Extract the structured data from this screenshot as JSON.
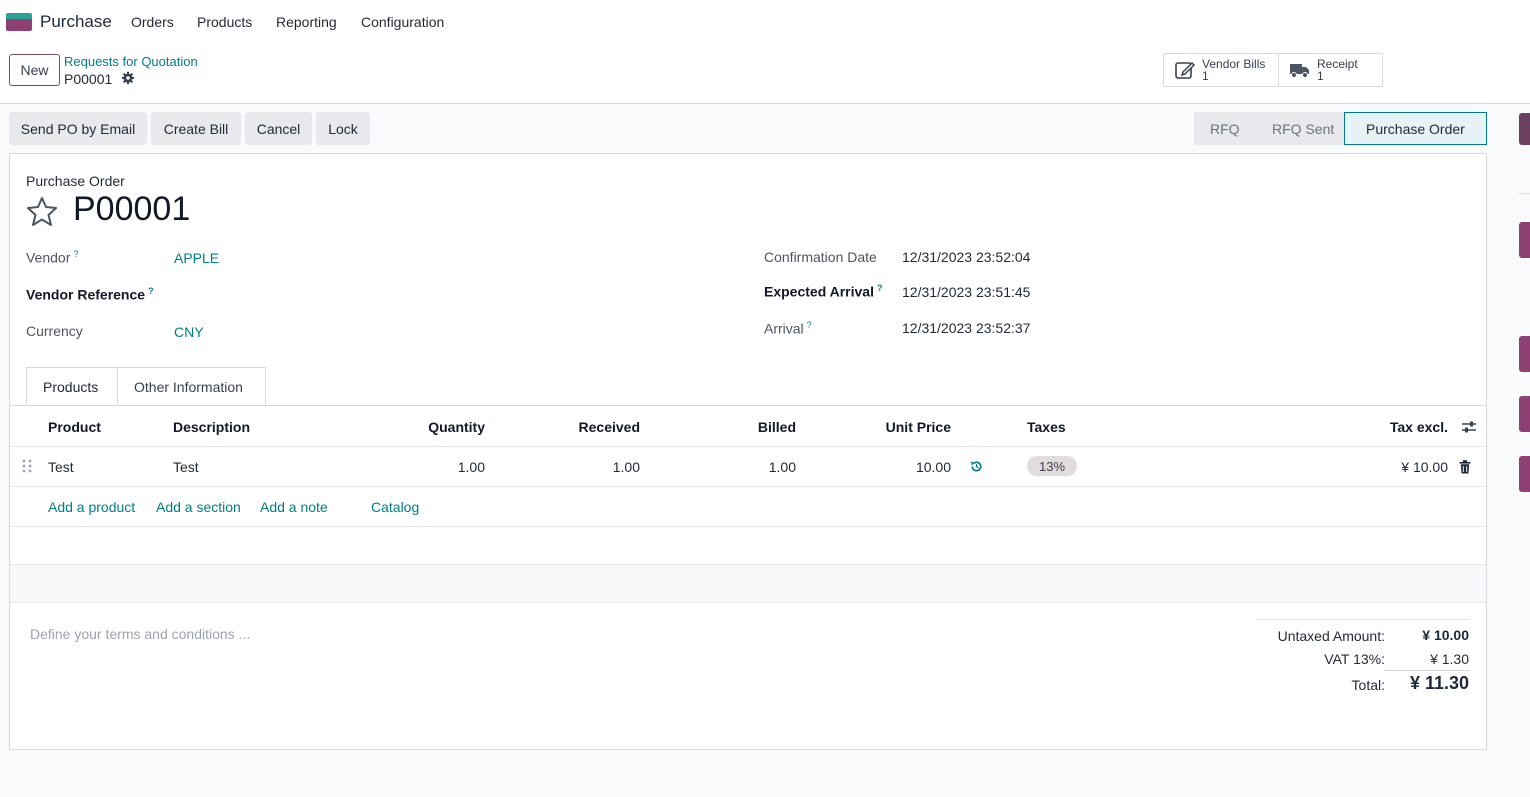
{
  "navbar": {
    "app_name": "Purchase",
    "menu": [
      "Orders",
      "Products",
      "Reporting",
      "Configuration"
    ]
  },
  "control": {
    "new_label": "New",
    "breadcrumb_parent": "Requests for Quotation",
    "breadcrumb_current": "P00001",
    "smart_buttons": [
      {
        "label": "Vendor Bills",
        "count": "1",
        "icon": "edit-document-icon"
      },
      {
        "label": "Receipt",
        "count": "1",
        "icon": "truck-icon"
      }
    ]
  },
  "actions": {
    "send_po": "Send PO by Email",
    "create_bill": "Create Bill",
    "cancel": "Cancel",
    "lock": "Lock"
  },
  "statusbar": [
    "RFQ",
    "RFQ Sent",
    "Purchase Order"
  ],
  "form": {
    "doc_type": "Purchase Order",
    "name": "P00001",
    "vendor_label": "Vendor",
    "vendor_value": "APPLE",
    "vendor_ref_label": "Vendor Reference",
    "currency_label": "Currency",
    "currency_value": "CNY",
    "confirm_label": "Confirmation Date",
    "confirm_value": "12/31/2023 23:52:04",
    "expected_label": "Expected Arrival",
    "expected_value": "12/31/2023 23:51:45",
    "arrival_label": "Arrival",
    "arrival_value": "12/31/2023 23:52:37",
    "help_mark": "?"
  },
  "tabs": [
    "Products",
    "Other Information"
  ],
  "lines": {
    "headers": {
      "product": "Product",
      "description": "Description",
      "quantity": "Quantity",
      "received": "Received",
      "billed": "Billed",
      "unit_price": "Unit Price",
      "taxes": "Taxes",
      "tax_excl": "Tax excl."
    },
    "rows": [
      {
        "product": "Test",
        "description": "Test",
        "quantity": "1.00",
        "received": "1.00",
        "billed": "1.00",
        "unit_price": "10.00",
        "tax": "13%",
        "subtotal": "¥ 10.00"
      }
    ],
    "add_product": "Add a product",
    "add_section": "Add a section",
    "add_note": "Add a note",
    "catalog": "Catalog"
  },
  "terms_placeholder": "Define your terms and conditions ...",
  "totals": {
    "untaxed_label": "Untaxed Amount:",
    "untaxed_value": "¥ 10.00",
    "vat_label": "VAT 13%:",
    "vat_value": "¥ 1.30",
    "total_label": "Total:",
    "total_value": "¥ 11.30"
  },
  "colors": {
    "brand": "#714b67",
    "link": "#017e84"
  }
}
